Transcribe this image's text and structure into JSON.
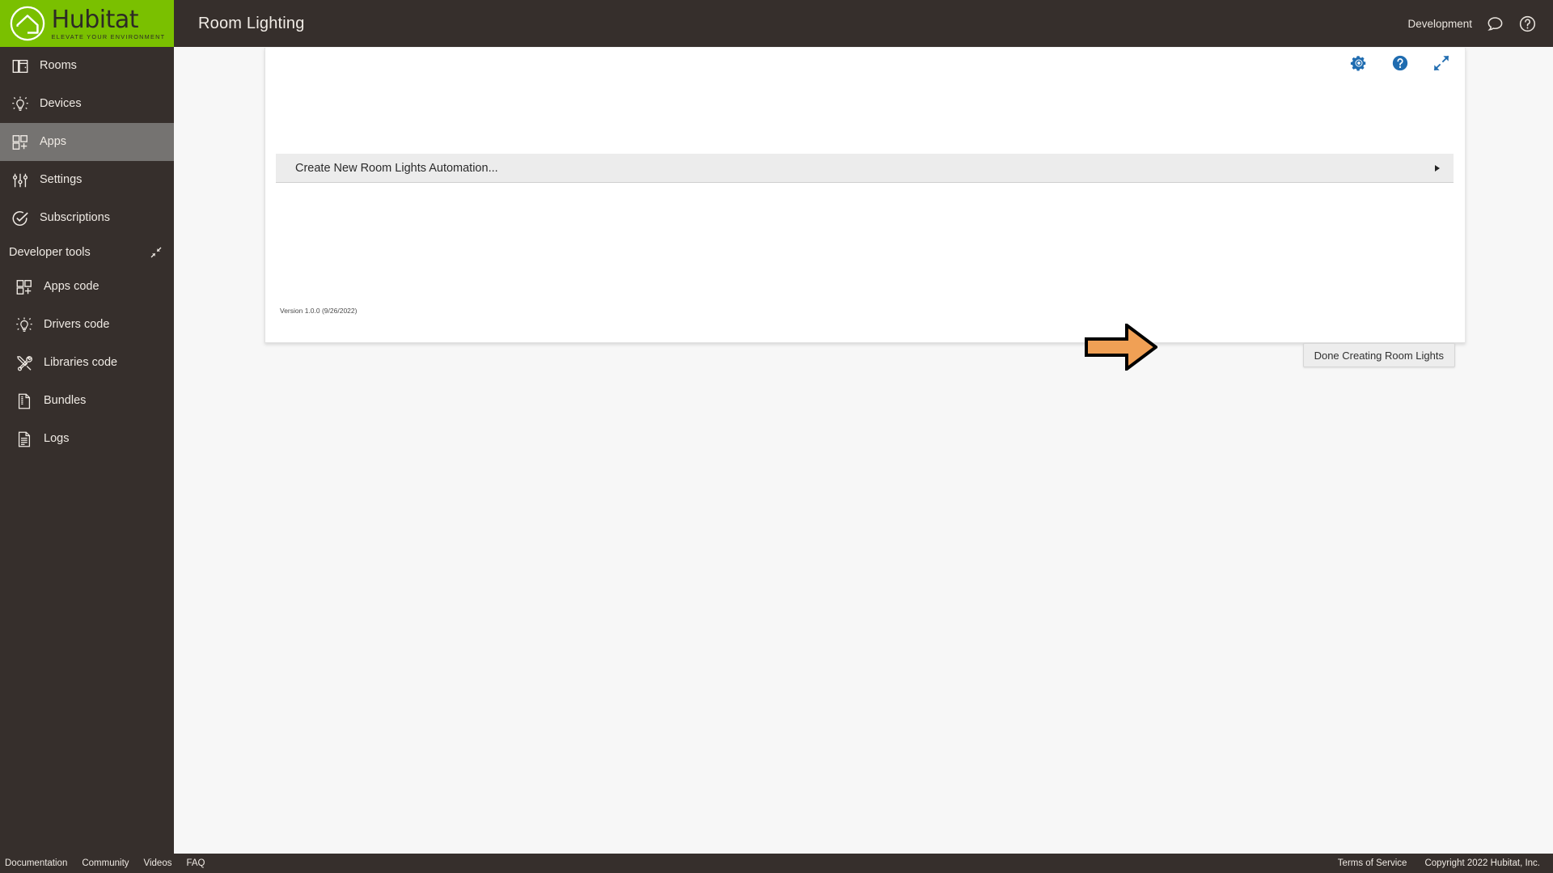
{
  "brand": {
    "name": "Hubitat",
    "tagline": "ELEVATE YOUR ENVIRONMENT",
    "green": "#7ac000",
    "dark": "#362f2c",
    "accent_blue": "#1f6cb0",
    "arrow_orange": "#f0a055"
  },
  "topbar": {
    "title": "Room Lighting",
    "location": "Development",
    "chat_icon": "chat-bubble-icon",
    "help_icon": "question-circle-icon"
  },
  "sidebar": {
    "items": [
      {
        "label": "Rooms",
        "icon": "rooms-icon",
        "active": false
      },
      {
        "label": "Devices",
        "icon": "bulb-icon",
        "active": false
      },
      {
        "label": "Apps",
        "icon": "apps-grid-icon",
        "active": true
      },
      {
        "label": "Settings",
        "icon": "sliders-icon",
        "active": false
      },
      {
        "label": "Subscriptions",
        "icon": "check-circle-icon",
        "active": false
      }
    ],
    "devtools": {
      "label": "Developer tools",
      "collapse_icon": "collapse-inward-icon",
      "items": [
        {
          "label": "Apps code",
          "icon": "apps-grid-icon"
        },
        {
          "label": "Drivers code",
          "icon": "bulb-icon"
        },
        {
          "label": "Libraries code",
          "icon": "tools-icon"
        },
        {
          "label": "Bundles",
          "icon": "zip-document-icon"
        },
        {
          "label": "Logs",
          "icon": "document-lines-icon"
        }
      ]
    }
  },
  "card": {
    "toolbar": [
      {
        "name": "gear-icon",
        "title": "Settings"
      },
      {
        "name": "question-circle-icon",
        "title": "Help"
      },
      {
        "name": "expand-diagonal-icon",
        "title": "Expand"
      }
    ],
    "create_row_label": "Create New Room Lights Automation...",
    "create_row_arrow": "triangle-right-icon",
    "version": "Version 1.0.0 (9/26/2022)",
    "done_button_label": "Done Creating Room Lights",
    "annotation_arrow": "orange-pointer-arrow"
  },
  "footer": {
    "links": [
      "Documentation",
      "Community",
      "Videos",
      "FAQ"
    ],
    "terms": "Terms of Service",
    "copyright": "Copyright 2022 Hubitat, Inc."
  }
}
